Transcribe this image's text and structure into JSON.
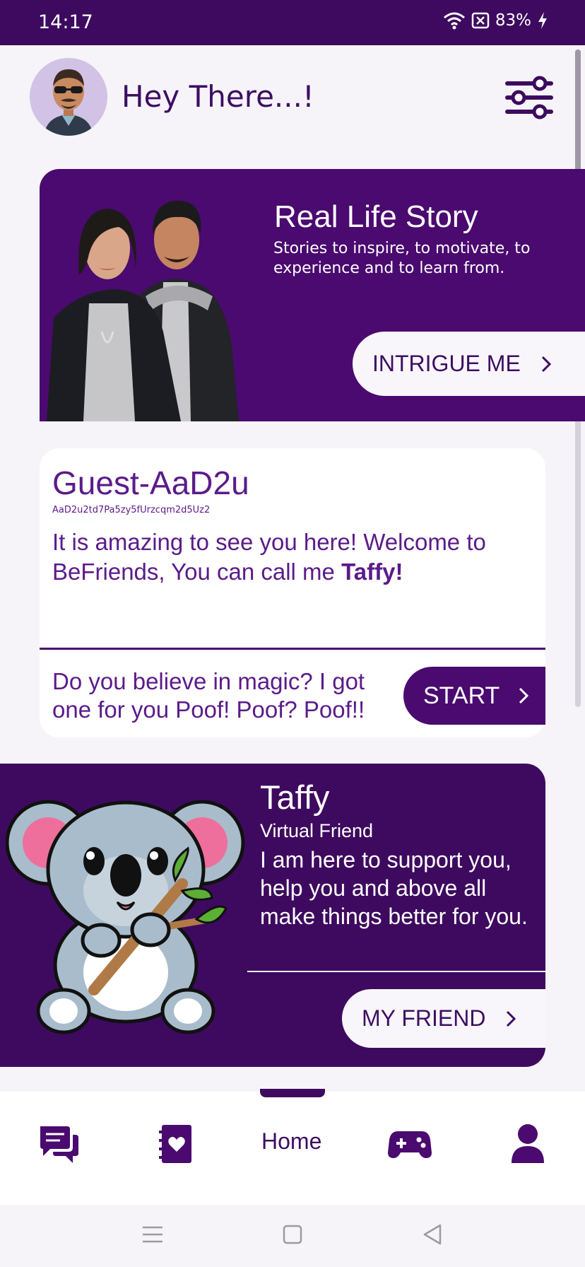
{
  "status_bar": {
    "time": "14:17",
    "battery": "83%"
  },
  "header": {
    "greeting": "Hey There...!",
    "avatar_icon": "avatar",
    "filter_icon": "sliders-icon"
  },
  "story_card": {
    "title": "Real Life Story",
    "subtitle": "Stories to inspire, to motivate, to experience and to learn from.",
    "button_label": "INTRIGUE ME"
  },
  "guest_card": {
    "name": "Guest-AaD2u",
    "id": "AaD2u2td7Pa5zy5fUrzcqm2d5Uz2",
    "welcome_text": "It is amazing to see you here! Welcome to BeFriends, You can call me ",
    "welcome_name": "Taffy!",
    "magic_text": "Do you believe in magic? I got one for you Poof! Poof? Poof!!",
    "start_label": "START"
  },
  "taffy_card": {
    "name": "Taffy",
    "role": "Virtual Friend",
    "description": "I am here to support you, help you and above all make things better for you.",
    "button_label": "MY FRIEND"
  },
  "bottom_nav": {
    "items": [
      {
        "icon": "chat-icon"
      },
      {
        "icon": "journal-heart-icon"
      },
      {
        "label": "Home"
      },
      {
        "icon": "gamepad-icon"
      },
      {
        "icon": "profile-icon"
      }
    ]
  },
  "colors": {
    "primary": "#3e0a5f",
    "accent_text": "#5b1b8a",
    "background": "#f6f4f9"
  }
}
